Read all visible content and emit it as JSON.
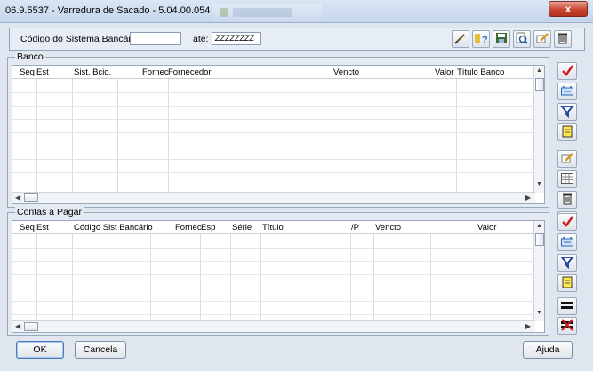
{
  "window": {
    "title": "06.9.5537 - Varredura de Sacado - 5.04.00.054",
    "close_label": "x"
  },
  "filter": {
    "codigo_label": "Código do Sistema Bancário:",
    "codigo_value": "",
    "ate_label": "até:",
    "ate_value": "ZZZZZZZZ"
  },
  "toolbar_icons": [
    "pencil-icon",
    "help-icon",
    "save-icon",
    "search-icon",
    "edit-icon",
    "trash-icon"
  ],
  "banco": {
    "title": "Banco",
    "columns": [
      "Seq",
      "Est",
      "Sist. Bcio.",
      "Fornec",
      "Fornecedor",
      "Vencto",
      "Valor",
      "Título Banco"
    ],
    "side_icons": [
      "check-icon",
      "link-icon",
      "filter-icon",
      "new-icon",
      "edit-icon",
      "grid-icon",
      "trash-icon",
      "clear-icon"
    ]
  },
  "contas": {
    "title": "Contas a Pagar",
    "columns": [
      "Seq",
      "Est",
      "Código Sist Bancário",
      "Fornec",
      "Esp",
      "Série",
      "Título",
      "/P",
      "Vencto",
      "Valor"
    ],
    "side_icons": [
      "check-icon",
      "link-icon",
      "filter-icon",
      "new-icon",
      "equals-icon",
      "not-equals-icon"
    ]
  },
  "buttons": {
    "ok": "OK",
    "cancela": "Cancela",
    "ajuda": "Ajuda"
  }
}
